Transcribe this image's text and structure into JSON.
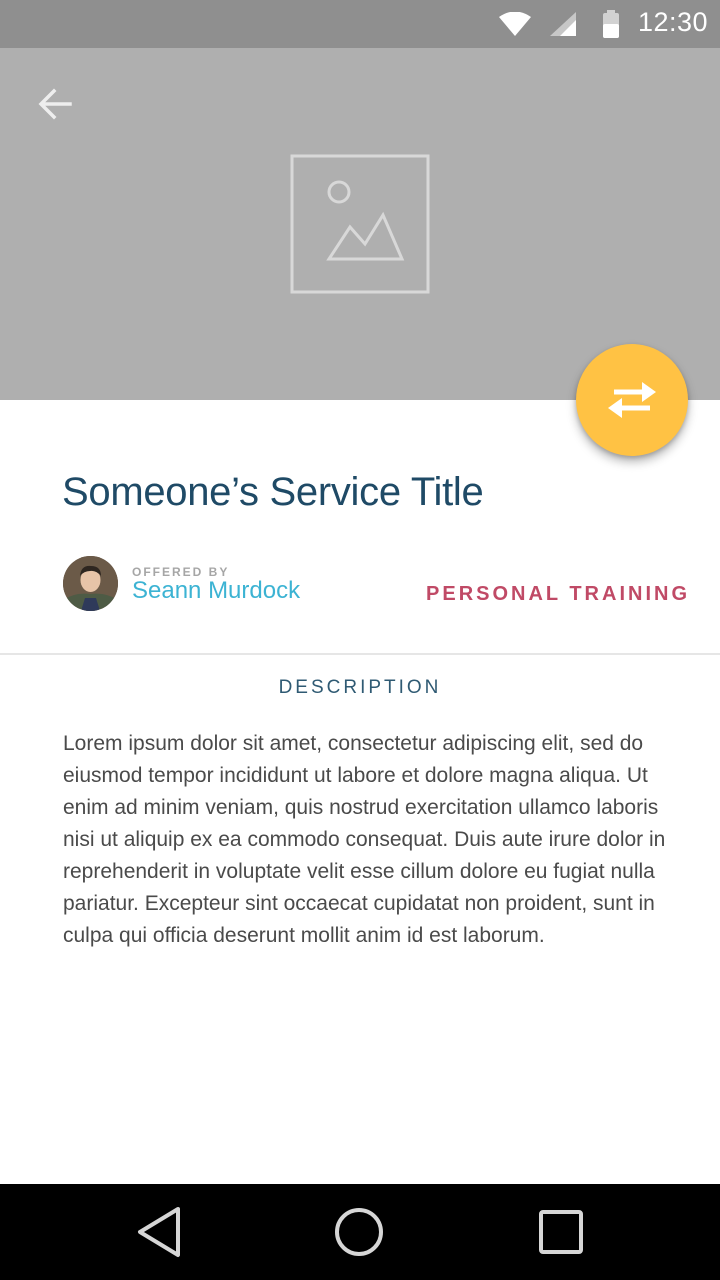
{
  "status_bar": {
    "time": "12:30",
    "icons": [
      "wifi-icon",
      "signal-icon",
      "battery-icon"
    ],
    "background": "#8f8f8f"
  },
  "hero": {
    "background": "#afafaf",
    "back_icon": "arrow-back-icon",
    "placeholder_icon": "image-placeholder-icon"
  },
  "fab": {
    "icon": "swap-arrows-icon",
    "color": "#ffc244"
  },
  "service": {
    "title": "Someone’s Service Title",
    "offered_by_label": "OFFERED BY",
    "author": "Seann Murdock",
    "category": "PERSONAL TRAINING"
  },
  "description": {
    "header": "DESCRIPTION",
    "body": "Lorem ipsum dolor sit amet, consectetur adipiscing elit, sed do eiusmod tempor incididunt ut labore et dolore magna aliqua. Ut enim ad minim veniam, quis nostrud exercitation ullamco laboris nisi ut aliquip ex ea commodo consequat. Duis aute irure dolor in reprehenderit in voluptate velit esse cillum dolore eu fugiat nulla pariatur. Excepteur sint occaecat cupidatat non proident, sunt in culpa qui officia deserunt mollit anim id est laborum."
  },
  "colors": {
    "title": "#1f4a66",
    "author": "#3cb3d3",
    "category": "#c04a66",
    "accent": "#ffc244"
  },
  "nav_bar": {
    "icons": [
      "nav-back-icon",
      "nav-home-icon",
      "nav-recent-icon"
    ]
  }
}
